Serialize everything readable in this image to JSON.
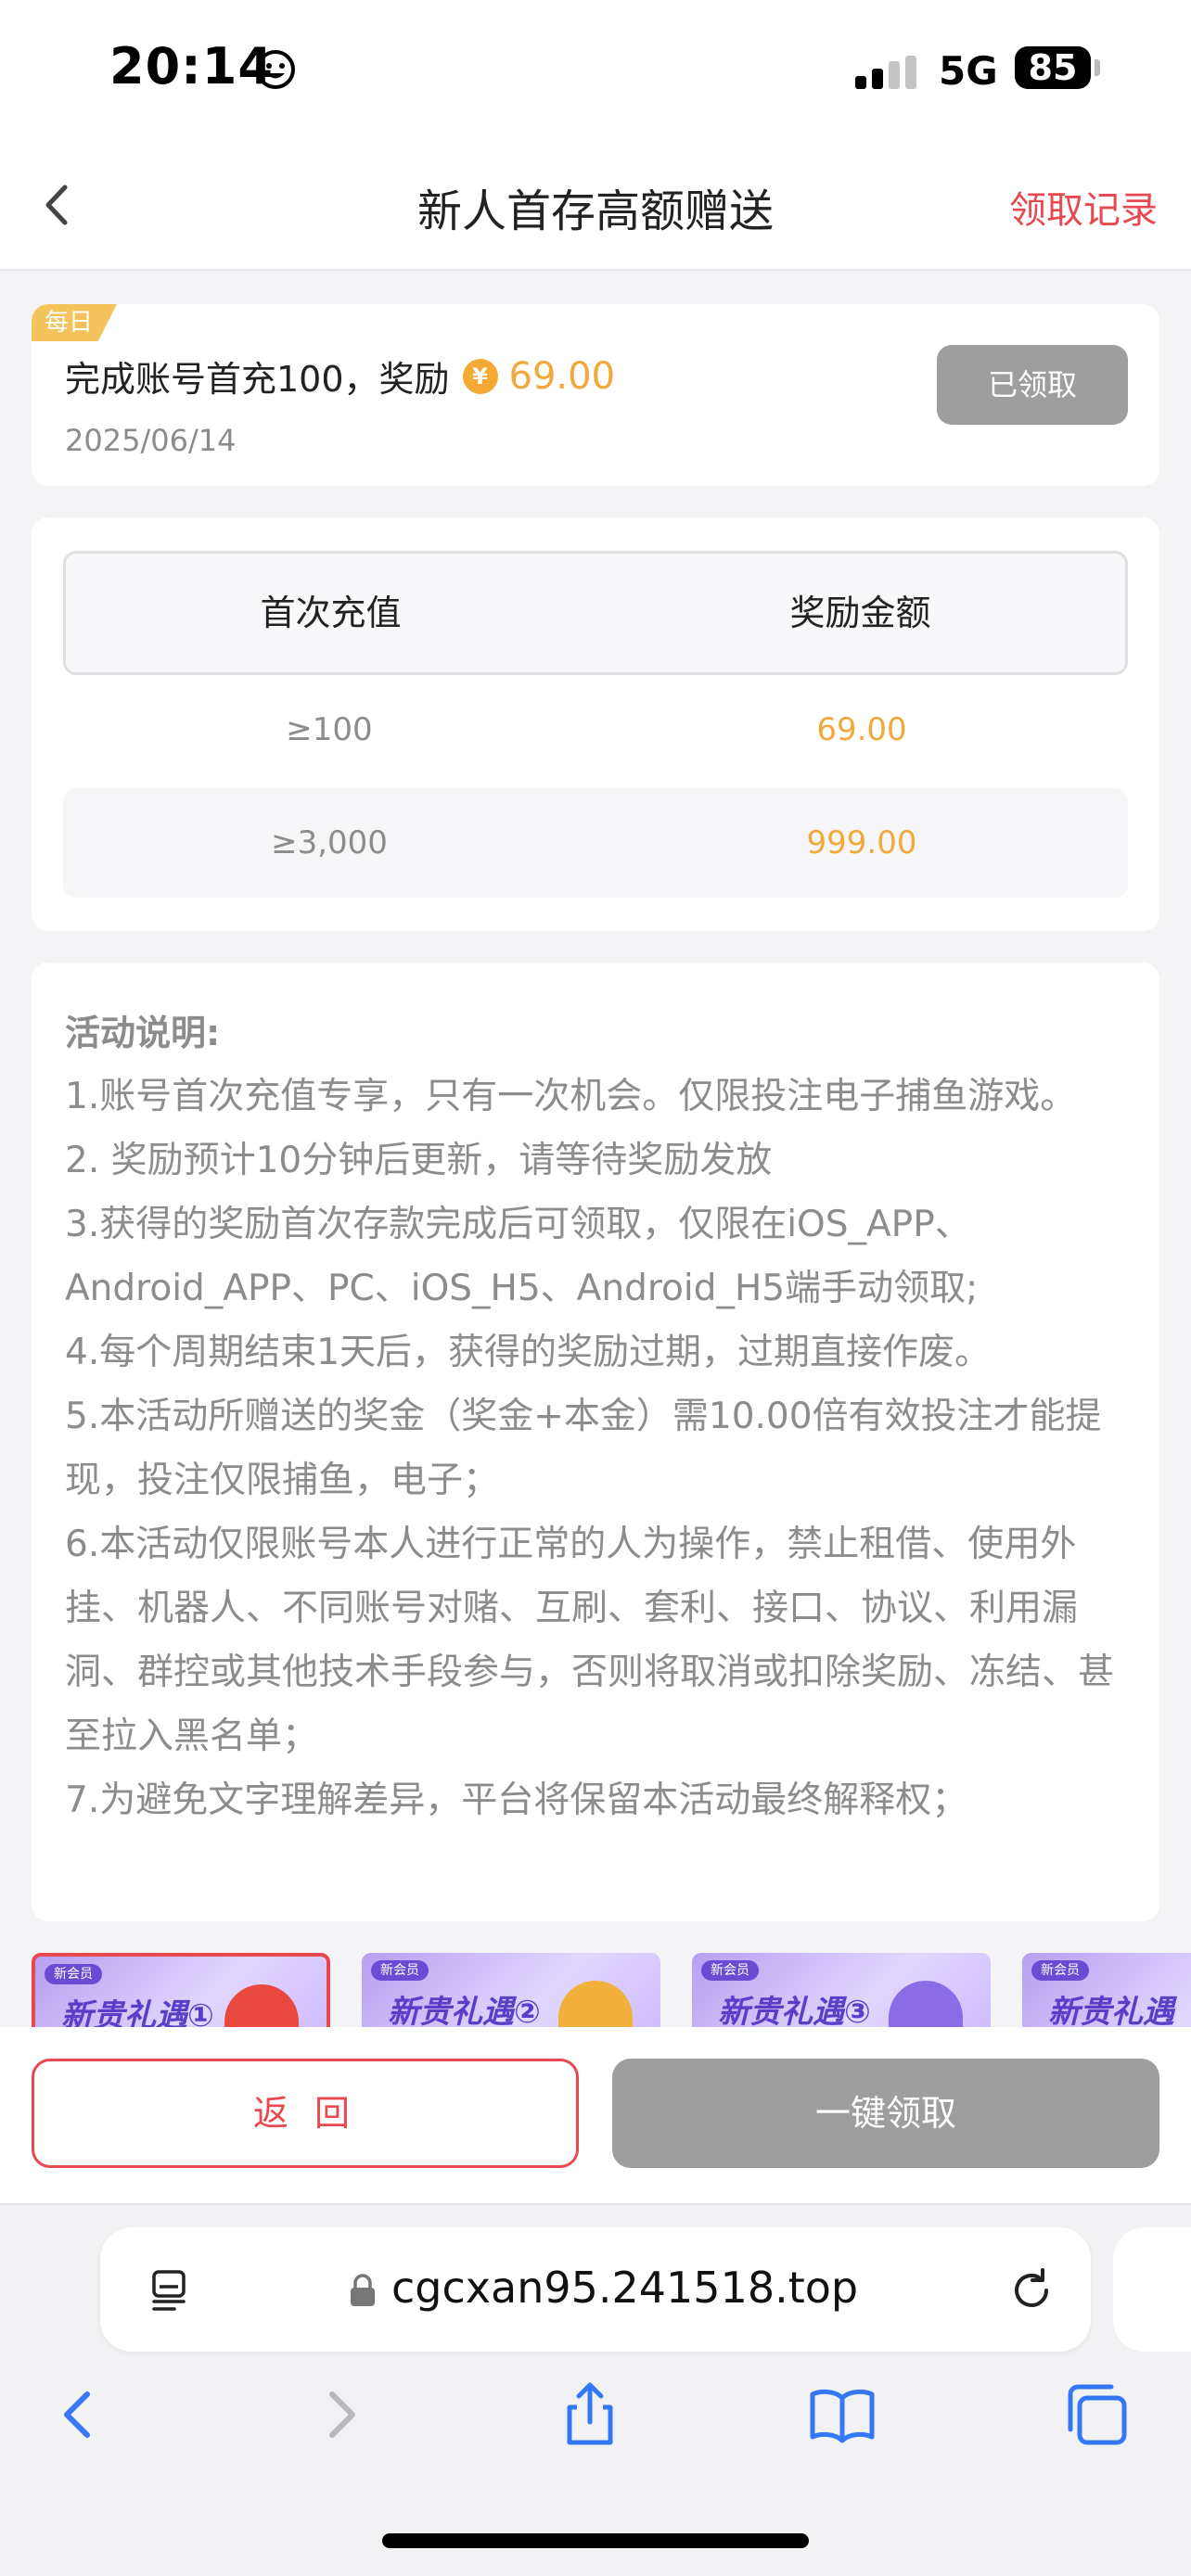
{
  "status_bar": {
    "time": "20:14",
    "network": "5G",
    "battery": "85"
  },
  "header": {
    "title": "新人首存高额赠送",
    "record_link": "领取记录"
  },
  "task": {
    "tag": "每日",
    "description": "完成账号首充100，奖励",
    "coin_symbol": "¥",
    "amount": "69.00",
    "date": "2025/06/14",
    "status_button": "已领取"
  },
  "reward_table": {
    "headers": [
      "首次充值",
      "奖励金额"
    ],
    "rows": [
      {
        "threshold": "≥100",
        "reward": "69.00"
      },
      {
        "threshold": "≥3,000",
        "reward": "999.00"
      }
    ]
  },
  "rules": {
    "title": "活动说明:",
    "items": [
      "1.账号首次充值专享，只有一次机会。仅限投注电子捕鱼游戏。",
      "2. 奖励预计10分钟后更新，请等待奖励发放",
      "3.获得的奖励首次存款完成后可领取，仅限在iOS_APP、Android_APP、PC、iOS_H5、Android_H5端手动领取;",
      "4.每个周期结束1天后，获得的奖励过期，过期直接作废。",
      "5.本活动所赠送的奖金（奖金+本金）需10.00倍有效投注才能提现，投注仅限捕鱼，电子；",
      "6.本活动仅限账号本人进行正常的人为操作，禁止租借、使用外挂、机器人、不同账号对赌、互刷、套利、接口、协议、利用漏洞、群控或其他技术手段参与，否则将取消或扣除奖励、冻结、甚至拉入黑名单；",
      "7.为避免文字理解差异，平台将保留本活动最终解释权；"
    ]
  },
  "banners": [
    {
      "badge": "新会员",
      "title": "新贵礼遇①"
    },
    {
      "badge": "新会员",
      "title": "新贵礼遇②"
    },
    {
      "badge": "新会员",
      "title": "新贵礼遇③"
    },
    {
      "badge": "新会员",
      "title": "新贵礼遇"
    }
  ],
  "actions": {
    "return": "返 回",
    "claim_all": "一键领取"
  },
  "browser": {
    "url": "cgcxan95.241518.top"
  },
  "colors": {
    "accent_red": "#e8484f",
    "gold": "#f2a93a",
    "disabled_gray": "#9e9e9e"
  }
}
